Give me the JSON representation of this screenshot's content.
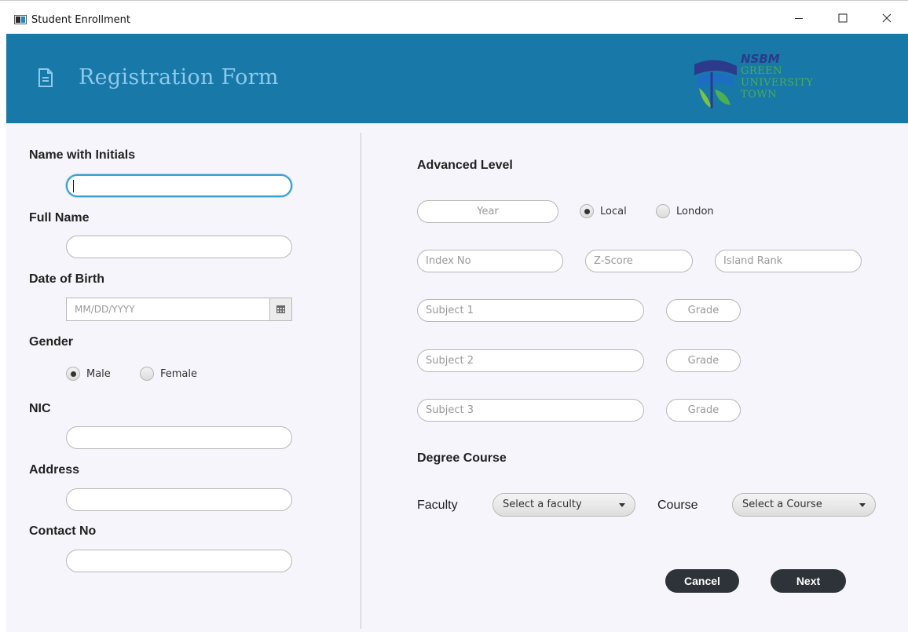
{
  "window": {
    "title": "Student Enrollment"
  },
  "header": {
    "title": "Registration Form",
    "logo": {
      "brand": "NSBM",
      "line1": "GREEN",
      "line2": "UNIVERSITY",
      "line3": "TOWN",
      "colors": {
        "green": "#4caf50",
        "navy": "#2d3a8c"
      }
    },
    "background": "#1878a8"
  },
  "personal": {
    "name_label": "Name with Initials",
    "name_value": "",
    "fullname_label": "Full Name",
    "dob_label": "Date of Birth",
    "dob_placeholder": "MM/DD/YYYY",
    "gender_label": "Gender",
    "gender_options": [
      "Male",
      "Female"
    ],
    "gender_selected": "Male",
    "nic_label": "NIC",
    "address_label": "Address",
    "contact_label": "Contact No"
  },
  "advanced": {
    "section_label": "Advanced Level",
    "year_placeholder": "Year",
    "exam_options": [
      "Local",
      "London"
    ],
    "exam_selected": "Local",
    "index_placeholder": "Index No",
    "zscore_placeholder": "Z-Score",
    "rank_placeholder": "Island Rank",
    "subjects": [
      {
        "subject_placeholder": "Subject 1",
        "grade_placeholder": "Grade"
      },
      {
        "subject_placeholder": "Subject 2",
        "grade_placeholder": "Grade"
      },
      {
        "subject_placeholder": "Subject 3",
        "grade_placeholder": "Grade"
      }
    ]
  },
  "degree": {
    "section_label": "Degree Course",
    "faculty_label": "Faculty",
    "faculty_value": "Select a faculty",
    "course_label": "Course",
    "course_value": "Select a Course"
  },
  "actions": {
    "cancel": "Cancel",
    "next": "Next"
  },
  "icons": {
    "app": "app-window-icon",
    "document": "document-icon",
    "calendar": "calendar-icon",
    "minimize": "minimize-icon",
    "maximize": "maximize-icon",
    "close": "close-icon"
  }
}
